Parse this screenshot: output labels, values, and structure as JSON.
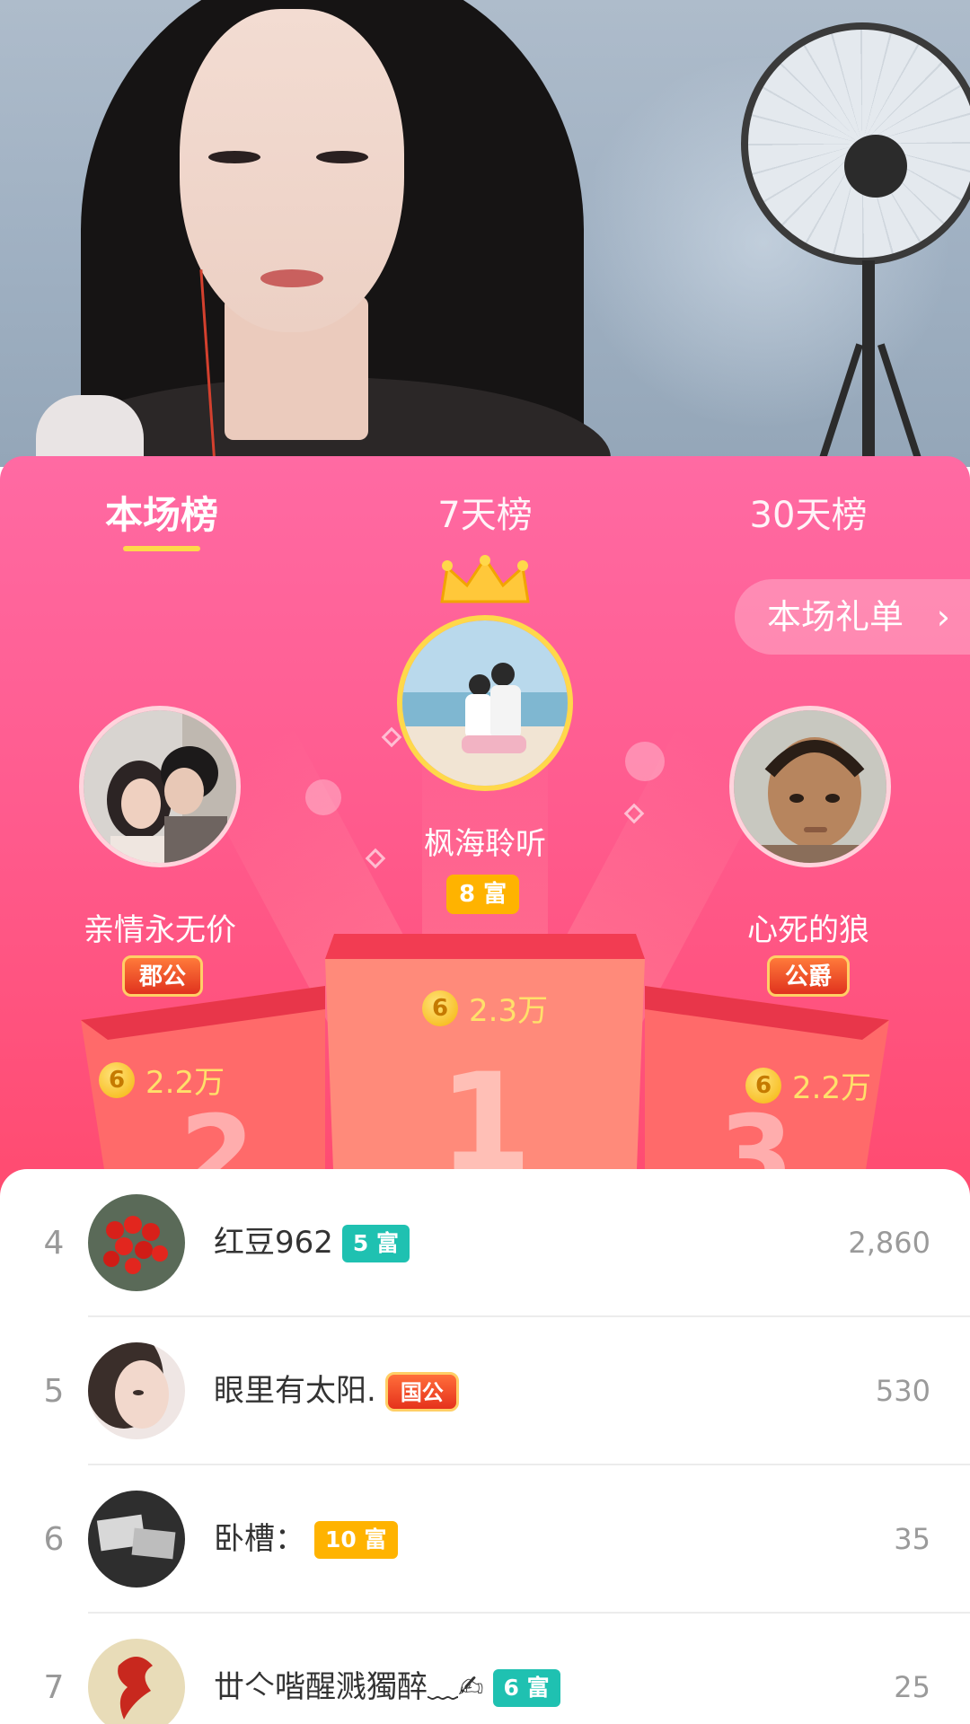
{
  "tabs": [
    {
      "label": "本场榜",
      "active": true
    },
    {
      "label": "7天榜",
      "active": false
    },
    {
      "label": "30天榜",
      "active": false
    }
  ],
  "gift_list_button": {
    "label": "本场礼单",
    "icon": "chevron-right-icon"
  },
  "coin_icon_glyph": "6",
  "top3": [
    {
      "rank": 1,
      "name": "枫海聆听",
      "badge": "8 富",
      "badge_color": "#ffb300",
      "score": "2.3万"
    },
    {
      "rank": 2,
      "name": "亲情永无价",
      "title_badge": "郡公",
      "score": "2.2万"
    },
    {
      "rank": 3,
      "name": "心死的狼",
      "title_badge": "公爵",
      "score": "2.2万"
    }
  ],
  "podium_numbers": {
    "first": "1",
    "second": "2",
    "third": "3"
  },
  "list": [
    {
      "rank": "4",
      "name": "红豆962",
      "badge": "5 富",
      "badge_color": "#1fc1b1",
      "value": "2,860"
    },
    {
      "rank": "5",
      "name": "眼里有太阳.",
      "title_badge": "国公",
      "value": "530"
    },
    {
      "rank": "6",
      "name": "卧槽：",
      "badge": "10 富",
      "badge_color": "#ffb300",
      "value": "35"
    },
    {
      "rank": "7",
      "name": "丗亽喈醒溅獨醉﹏✍",
      "badge": "6 富",
      "badge_color": "#1fc1b1",
      "value": "25"
    }
  ]
}
